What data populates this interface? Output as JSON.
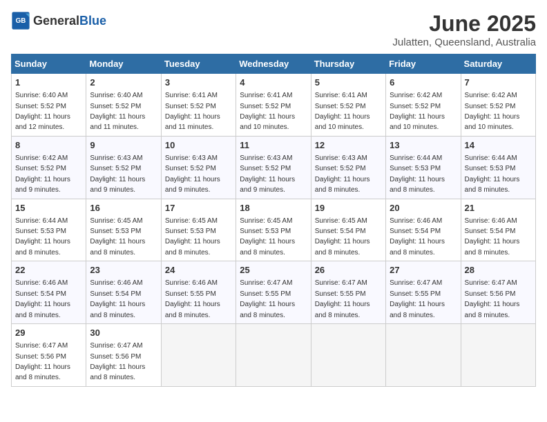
{
  "header": {
    "logo_general": "General",
    "logo_blue": "Blue",
    "title": "June 2025",
    "subtitle": "Julatten, Queensland, Australia"
  },
  "calendar": {
    "days_of_week": [
      "Sunday",
      "Monday",
      "Tuesday",
      "Wednesday",
      "Thursday",
      "Friday",
      "Saturday"
    ],
    "weeks": [
      {
        "days": [
          {
            "num": "1",
            "sunrise": "6:40 AM",
            "sunset": "5:52 PM",
            "daylight": "11 hours and 12 minutes."
          },
          {
            "num": "2",
            "sunrise": "6:40 AM",
            "sunset": "5:52 PM",
            "daylight": "11 hours and 11 minutes."
          },
          {
            "num": "3",
            "sunrise": "6:41 AM",
            "sunset": "5:52 PM",
            "daylight": "11 hours and 11 minutes."
          },
          {
            "num": "4",
            "sunrise": "6:41 AM",
            "sunset": "5:52 PM",
            "daylight": "11 hours and 10 minutes."
          },
          {
            "num": "5",
            "sunrise": "6:41 AM",
            "sunset": "5:52 PM",
            "daylight": "11 hours and 10 minutes."
          },
          {
            "num": "6",
            "sunrise": "6:42 AM",
            "sunset": "5:52 PM",
            "daylight": "11 hours and 10 minutes."
          },
          {
            "num": "7",
            "sunrise": "6:42 AM",
            "sunset": "5:52 PM",
            "daylight": "11 hours and 10 minutes."
          }
        ]
      },
      {
        "days": [
          {
            "num": "8",
            "sunrise": "6:42 AM",
            "sunset": "5:52 PM",
            "daylight": "11 hours and 9 minutes."
          },
          {
            "num": "9",
            "sunrise": "6:43 AM",
            "sunset": "5:52 PM",
            "daylight": "11 hours and 9 minutes."
          },
          {
            "num": "10",
            "sunrise": "6:43 AM",
            "sunset": "5:52 PM",
            "daylight": "11 hours and 9 minutes."
          },
          {
            "num": "11",
            "sunrise": "6:43 AM",
            "sunset": "5:52 PM",
            "daylight": "11 hours and 9 minutes."
          },
          {
            "num": "12",
            "sunrise": "6:43 AM",
            "sunset": "5:52 PM",
            "daylight": "11 hours and 8 minutes."
          },
          {
            "num": "13",
            "sunrise": "6:44 AM",
            "sunset": "5:53 PM",
            "daylight": "11 hours and 8 minutes."
          },
          {
            "num": "14",
            "sunrise": "6:44 AM",
            "sunset": "5:53 PM",
            "daylight": "11 hours and 8 minutes."
          }
        ]
      },
      {
        "days": [
          {
            "num": "15",
            "sunrise": "6:44 AM",
            "sunset": "5:53 PM",
            "daylight": "11 hours and 8 minutes."
          },
          {
            "num": "16",
            "sunrise": "6:45 AM",
            "sunset": "5:53 PM",
            "daylight": "11 hours and 8 minutes."
          },
          {
            "num": "17",
            "sunrise": "6:45 AM",
            "sunset": "5:53 PM",
            "daylight": "11 hours and 8 minutes."
          },
          {
            "num": "18",
            "sunrise": "6:45 AM",
            "sunset": "5:53 PM",
            "daylight": "11 hours and 8 minutes."
          },
          {
            "num": "19",
            "sunrise": "6:45 AM",
            "sunset": "5:54 PM",
            "daylight": "11 hours and 8 minutes."
          },
          {
            "num": "20",
            "sunrise": "6:46 AM",
            "sunset": "5:54 PM",
            "daylight": "11 hours and 8 minutes."
          },
          {
            "num": "21",
            "sunrise": "6:46 AM",
            "sunset": "5:54 PM",
            "daylight": "11 hours and 8 minutes."
          }
        ]
      },
      {
        "days": [
          {
            "num": "22",
            "sunrise": "6:46 AM",
            "sunset": "5:54 PM",
            "daylight": "11 hours and 8 minutes."
          },
          {
            "num": "23",
            "sunrise": "6:46 AM",
            "sunset": "5:54 PM",
            "daylight": "11 hours and 8 minutes."
          },
          {
            "num": "24",
            "sunrise": "6:46 AM",
            "sunset": "5:55 PM",
            "daylight": "11 hours and 8 minutes."
          },
          {
            "num": "25",
            "sunrise": "6:47 AM",
            "sunset": "5:55 PM",
            "daylight": "11 hours and 8 minutes."
          },
          {
            "num": "26",
            "sunrise": "6:47 AM",
            "sunset": "5:55 PM",
            "daylight": "11 hours and 8 minutes."
          },
          {
            "num": "27",
            "sunrise": "6:47 AM",
            "sunset": "5:55 PM",
            "daylight": "11 hours and 8 minutes."
          },
          {
            "num": "28",
            "sunrise": "6:47 AM",
            "sunset": "5:56 PM",
            "daylight": "11 hours and 8 minutes."
          }
        ]
      },
      {
        "days": [
          {
            "num": "29",
            "sunrise": "6:47 AM",
            "sunset": "5:56 PM",
            "daylight": "11 hours and 8 minutes."
          },
          {
            "num": "30",
            "sunrise": "6:47 AM",
            "sunset": "5:56 PM",
            "daylight": "11 hours and 8 minutes."
          },
          null,
          null,
          null,
          null,
          null
        ]
      }
    ],
    "labels": {
      "sunrise": "Sunrise:",
      "sunset": "Sunset:",
      "daylight": "Daylight:"
    }
  }
}
